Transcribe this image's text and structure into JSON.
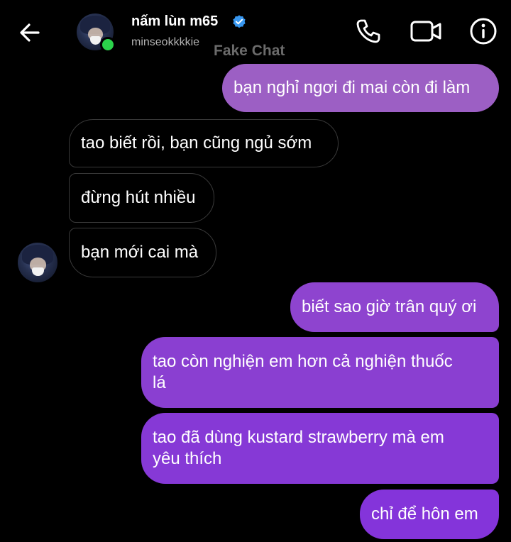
{
  "header": {
    "contact_name": "nấm lùn m65",
    "username": "minseokkkkie",
    "verified": true,
    "online": true,
    "icons": {
      "back": "back-arrow-icon",
      "call": "phone-icon",
      "video": "video-camera-icon",
      "info": "info-icon",
      "verified": "verified-badge-icon"
    }
  },
  "watermark": "Fake Chat",
  "colors": {
    "background": "#000000",
    "sent_bubble_top": "#9c5fc4",
    "sent_bubble_bottom": "#8434da",
    "received_bubble_border": "#3a3a3a",
    "online_dot": "#2bd34b",
    "verified_badge": "#3897f0"
  },
  "messages": [
    {
      "sender": "me",
      "text": "bạn nghỉ ngơi đi mai còn đi làm"
    },
    {
      "sender": "them",
      "text": "tao biết rồi, bạn cũng ngủ sớm"
    },
    {
      "sender": "them",
      "text": "đừng hút nhiều"
    },
    {
      "sender": "them",
      "text": "bạn mới cai mà"
    },
    {
      "sender": "me",
      "text": "biết sao giờ trân quý ơi"
    },
    {
      "sender": "me",
      "text_line1": "tao còn nghiện em hơn cả nghiện thuốc",
      "text_line2": "lá"
    },
    {
      "sender": "me",
      "text_line1": "tao đã dùng kustard strawberry mà em",
      "text_line2": "yêu thích"
    },
    {
      "sender": "me",
      "text": "chỉ để hôn em"
    }
  ]
}
